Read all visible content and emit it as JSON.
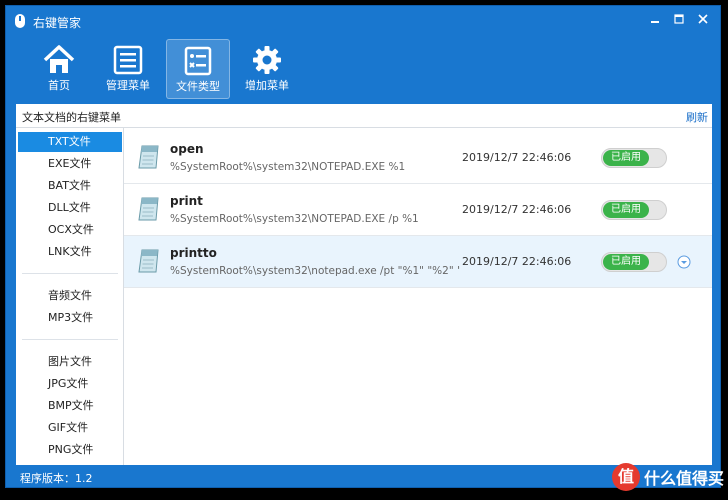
{
  "window": {
    "title": "右键管家",
    "controls": [
      "minimize-icon",
      "restore-icon",
      "close-icon"
    ]
  },
  "toolbar": {
    "items": [
      {
        "label": "首页",
        "icon": "home-icon",
        "active": false
      },
      {
        "label": "管理菜单",
        "icon": "menu-list-icon",
        "active": false
      },
      {
        "label": "文件类型",
        "icon": "file-type-icon",
        "active": true
      },
      {
        "label": "增加菜单",
        "icon": "gear-icon",
        "active": false
      }
    ]
  },
  "subheader": {
    "label": "文本文档的右键菜单",
    "refresh": "刷新"
  },
  "sidebar": {
    "groups": [
      [
        "TXT文件",
        "EXE文件",
        "BAT文件",
        "DLL文件",
        "OCX文件",
        "LNK文件"
      ],
      [
        "音频文件",
        "MP3文件"
      ],
      [
        "图片文件",
        "JPG文件",
        "BMP文件",
        "GIF文件",
        "PNG文件"
      ]
    ],
    "selected": "TXT文件"
  },
  "entries": [
    {
      "name": "open",
      "command": "%SystemRoot%\\system32\\NOTEPAD.EXE %1",
      "time": "2019/12/7 22:46:06",
      "status": "已启用",
      "selected": false
    },
    {
      "name": "print",
      "command": "%SystemRoot%\\system32\\NOTEPAD.EXE /p %1",
      "time": "2019/12/7 22:46:06",
      "status": "已启用",
      "selected": false
    },
    {
      "name": "printto",
      "command": "%SystemRoot%\\system32\\notepad.exe /pt \"%1\" \"%2\" \"%...",
      "time": "2019/12/7 22:46:06",
      "status": "已启用",
      "selected": true
    }
  ],
  "status": {
    "version": "程序版本：1.2"
  },
  "watermark": {
    "badge": "值",
    "text": "什么值得买"
  }
}
